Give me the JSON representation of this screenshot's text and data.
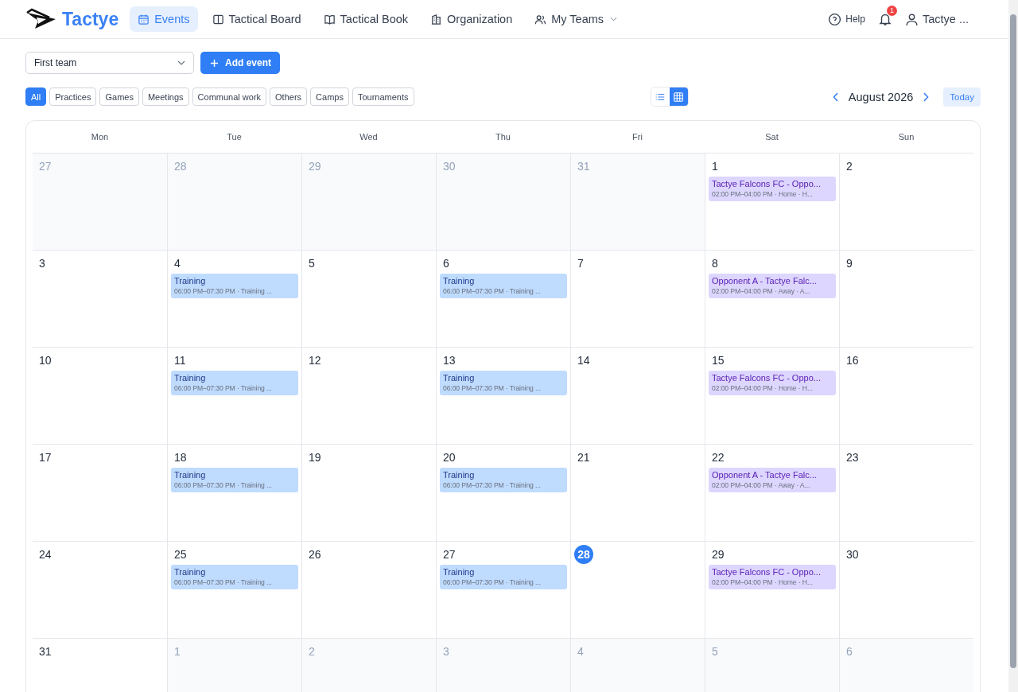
{
  "brand": {
    "name": "Tactye"
  },
  "nav": [
    {
      "label": "Events",
      "kind": "calendar",
      "selected": true
    },
    {
      "label": "Tactical Board",
      "kind": "board",
      "selected": false
    },
    {
      "label": "Tactical Book",
      "kind": "book",
      "selected": false
    },
    {
      "label": "Organization",
      "kind": "building",
      "selected": false
    },
    {
      "label": "My Teams",
      "kind": "users",
      "selected": false,
      "dropdown": true
    }
  ],
  "help": {
    "label": "Help"
  },
  "notifications": {
    "badge": "1"
  },
  "user": {
    "name": "Tactye ..."
  },
  "team_select": {
    "value": "First team"
  },
  "add_button": {
    "label": "Add event"
  },
  "filters": [
    {
      "label": "All",
      "selected": true
    },
    {
      "label": "Practices",
      "selected": false
    },
    {
      "label": "Games",
      "selected": false
    },
    {
      "label": "Meetings",
      "selected": false
    },
    {
      "label": "Communal work",
      "selected": false
    },
    {
      "label": "Others",
      "selected": false
    },
    {
      "label": "Camps",
      "selected": false
    },
    {
      "label": "Tournaments",
      "selected": false
    }
  ],
  "views": [
    {
      "kind": "list",
      "selected": false
    },
    {
      "kind": "grid",
      "selected": true
    }
  ],
  "month": {
    "title": "August 2026",
    "today_label": "Today"
  },
  "weekdays": [
    "Mon",
    "Tue",
    "Wed",
    "Thu",
    "Fri",
    "Sat",
    "Sun"
  ],
  "weeks": [
    [
      {
        "day": "27",
        "outside": true
      },
      {
        "day": "28",
        "outside": true
      },
      {
        "day": "29",
        "outside": true
      },
      {
        "day": "30",
        "outside": true
      },
      {
        "day": "31",
        "outside": true
      },
      {
        "day": "1",
        "events": [
          {
            "kind": "game",
            "title": "Tactye Falcons FC - Oppo...",
            "details": "02:00 PM–04:00 PM · Home · H..."
          }
        ]
      },
      {
        "day": "2"
      }
    ],
    [
      {
        "day": "3"
      },
      {
        "day": "4",
        "events": [
          {
            "kind": "practice",
            "title": "Training",
            "details": "06:00 PM–07:30 PM · Training ..."
          }
        ]
      },
      {
        "day": "5"
      },
      {
        "day": "6",
        "events": [
          {
            "kind": "practice",
            "title": "Training",
            "details": "06:00 PM–07:30 PM · Training ..."
          }
        ]
      },
      {
        "day": "7"
      },
      {
        "day": "8",
        "events": [
          {
            "kind": "game",
            "title": "Opponent A - Tactye Falc...",
            "details": "02:00 PM–04:00 PM · Away · A..."
          }
        ]
      },
      {
        "day": "9"
      }
    ],
    [
      {
        "day": "10"
      },
      {
        "day": "11",
        "events": [
          {
            "kind": "practice",
            "title": "Training",
            "details": "06:00 PM–07:30 PM · Training ..."
          }
        ]
      },
      {
        "day": "12"
      },
      {
        "day": "13",
        "events": [
          {
            "kind": "practice",
            "title": "Training",
            "details": "06:00 PM–07:30 PM · Training ..."
          }
        ]
      },
      {
        "day": "14"
      },
      {
        "day": "15",
        "events": [
          {
            "kind": "game",
            "title": "Tactye Falcons FC - Oppo...",
            "details": "02:00 PM–04:00 PM · Home · H..."
          }
        ]
      },
      {
        "day": "16"
      }
    ],
    [
      {
        "day": "17"
      },
      {
        "day": "18",
        "events": [
          {
            "kind": "practice",
            "title": "Training",
            "details": "06:00 PM–07:30 PM · Training ..."
          }
        ]
      },
      {
        "day": "19"
      },
      {
        "day": "20",
        "events": [
          {
            "kind": "practice",
            "title": "Training",
            "details": "06:00 PM–07:30 PM · Training ..."
          }
        ]
      },
      {
        "day": "21"
      },
      {
        "day": "22",
        "events": [
          {
            "kind": "game",
            "title": "Opponent A - Tactye Falc...",
            "details": "02:00 PM–04:00 PM · Away · A..."
          }
        ]
      },
      {
        "day": "23"
      }
    ],
    [
      {
        "day": "24"
      },
      {
        "day": "25",
        "events": [
          {
            "kind": "practice",
            "title": "Training",
            "details": "06:00 PM–07:30 PM · Training ..."
          }
        ]
      },
      {
        "day": "26"
      },
      {
        "day": "27",
        "events": [
          {
            "kind": "practice",
            "title": "Training",
            "details": "06:00 PM–07:30 PM · Training ..."
          }
        ]
      },
      {
        "day": "28",
        "today": true
      },
      {
        "day": "29",
        "events": [
          {
            "kind": "game",
            "title": "Tactye Falcons FC - Oppo...",
            "details": "02:00 PM–04:00 PM · Home · H..."
          }
        ]
      },
      {
        "day": "30"
      }
    ],
    [
      {
        "day": "31"
      },
      {
        "day": "1",
        "outside": true
      },
      {
        "day": "2",
        "outside": true
      },
      {
        "day": "3",
        "outside": true
      },
      {
        "day": "4",
        "outside": true
      },
      {
        "day": "5",
        "outside": true
      },
      {
        "day": "6",
        "outside": true
      }
    ]
  ]
}
